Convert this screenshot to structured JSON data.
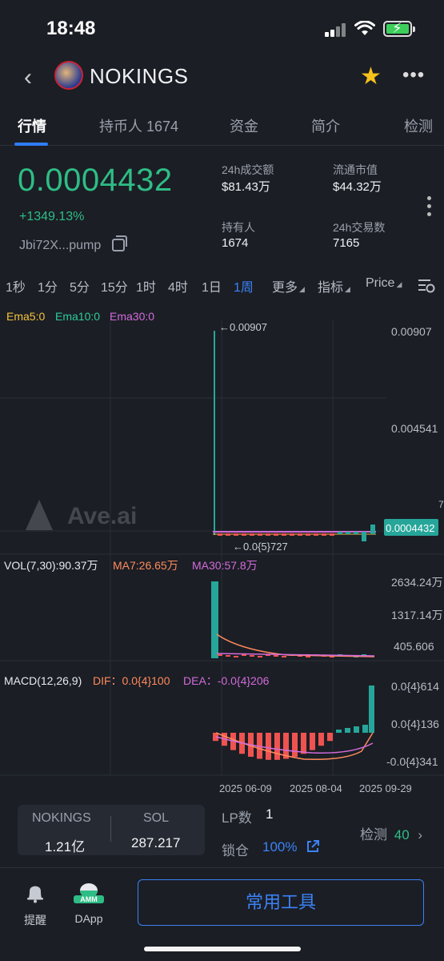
{
  "status": {
    "time": "18:48"
  },
  "header": {
    "token_name": "NOKINGS"
  },
  "tabs": [
    {
      "label": "行情"
    },
    {
      "label": "持币人 1674"
    },
    {
      "label": "资金"
    },
    {
      "label": "简介"
    },
    {
      "label": "检测"
    }
  ],
  "price": {
    "value": "0.0004432",
    "change": "+1349.13%",
    "address": "Jbi72X...pump"
  },
  "stats": {
    "volume_label": "24h成交额",
    "volume_value": "$81.43万",
    "mcap_label": "流通市值",
    "mcap_value": "$44.32万",
    "holders_label": "持有人",
    "holders_value": "1674",
    "txs_label": "24h交易数",
    "txs_value": "7165"
  },
  "timeframes": [
    {
      "label": "1秒"
    },
    {
      "label": "1分"
    },
    {
      "label": "5分"
    },
    {
      "label": "15分"
    },
    {
      "label": "1时"
    },
    {
      "label": "4时"
    },
    {
      "label": "1日"
    },
    {
      "label": "1周"
    },
    {
      "label": "更多"
    },
    {
      "label": "指标"
    },
    {
      "label": "Price"
    }
  ],
  "chart_data": {
    "type": "bar",
    "ema_legend": {
      "ema5": "Ema5:0",
      "ema10": "Ema10:0",
      "ema30": "Ema30:0"
    },
    "price_axis": {
      "top": "0.00907",
      "mid": "0.004541",
      "current": "0.0004432",
      "cut": "7"
    },
    "high_marker": "←0.00907",
    "low_marker": "←0.0{5}727",
    "watermark": "Ave.ai",
    "vol_legend": {
      "vol": "VOL(7,30):90.37万",
      "ma7": "MA7:26.65万",
      "ma30": "MA30:57.8万"
    },
    "vol_axis": {
      "top": "2634.24万",
      "mid": "1317.14万",
      "low": "405.606"
    },
    "macd_legend": {
      "macd": "MACD(12,26,9)",
      "dif": "DIF：0.0{4}100",
      "dea": "DEA：-0.0{4}206"
    },
    "macd_axis": {
      "top": "0.0{4}614",
      "mid": "0.0{4}136",
      "low": "-0.0{4}341"
    },
    "dates": [
      "2025 06-09",
      "2025 08-04",
      "2025 09-29"
    ],
    "colors": {
      "up": "#26a69a",
      "down": "#ef5350",
      "ema5": "#f5c33b",
      "ema10": "#2ecc9a",
      "ema30": "#d36bdb",
      "ma7": "#ff8a5c",
      "ma30": "#d36bdb",
      "dif": "#ff8a5c",
      "dea": "#d36bdb"
    }
  },
  "footer": {
    "left_token": "NOKINGS",
    "left_value": "1.21亿",
    "right_token": "SOL",
    "right_value": "287.217",
    "lp_label": "LP数",
    "lp_value": "1",
    "lock_label": "锁仓",
    "lock_value": "100%",
    "check_label": "检测",
    "check_value": "40"
  },
  "bottom_nav": {
    "remind_label": "提醒",
    "dapp_label": "DApp",
    "dapp_badge": "AMM",
    "tools_label": "常用工具"
  }
}
